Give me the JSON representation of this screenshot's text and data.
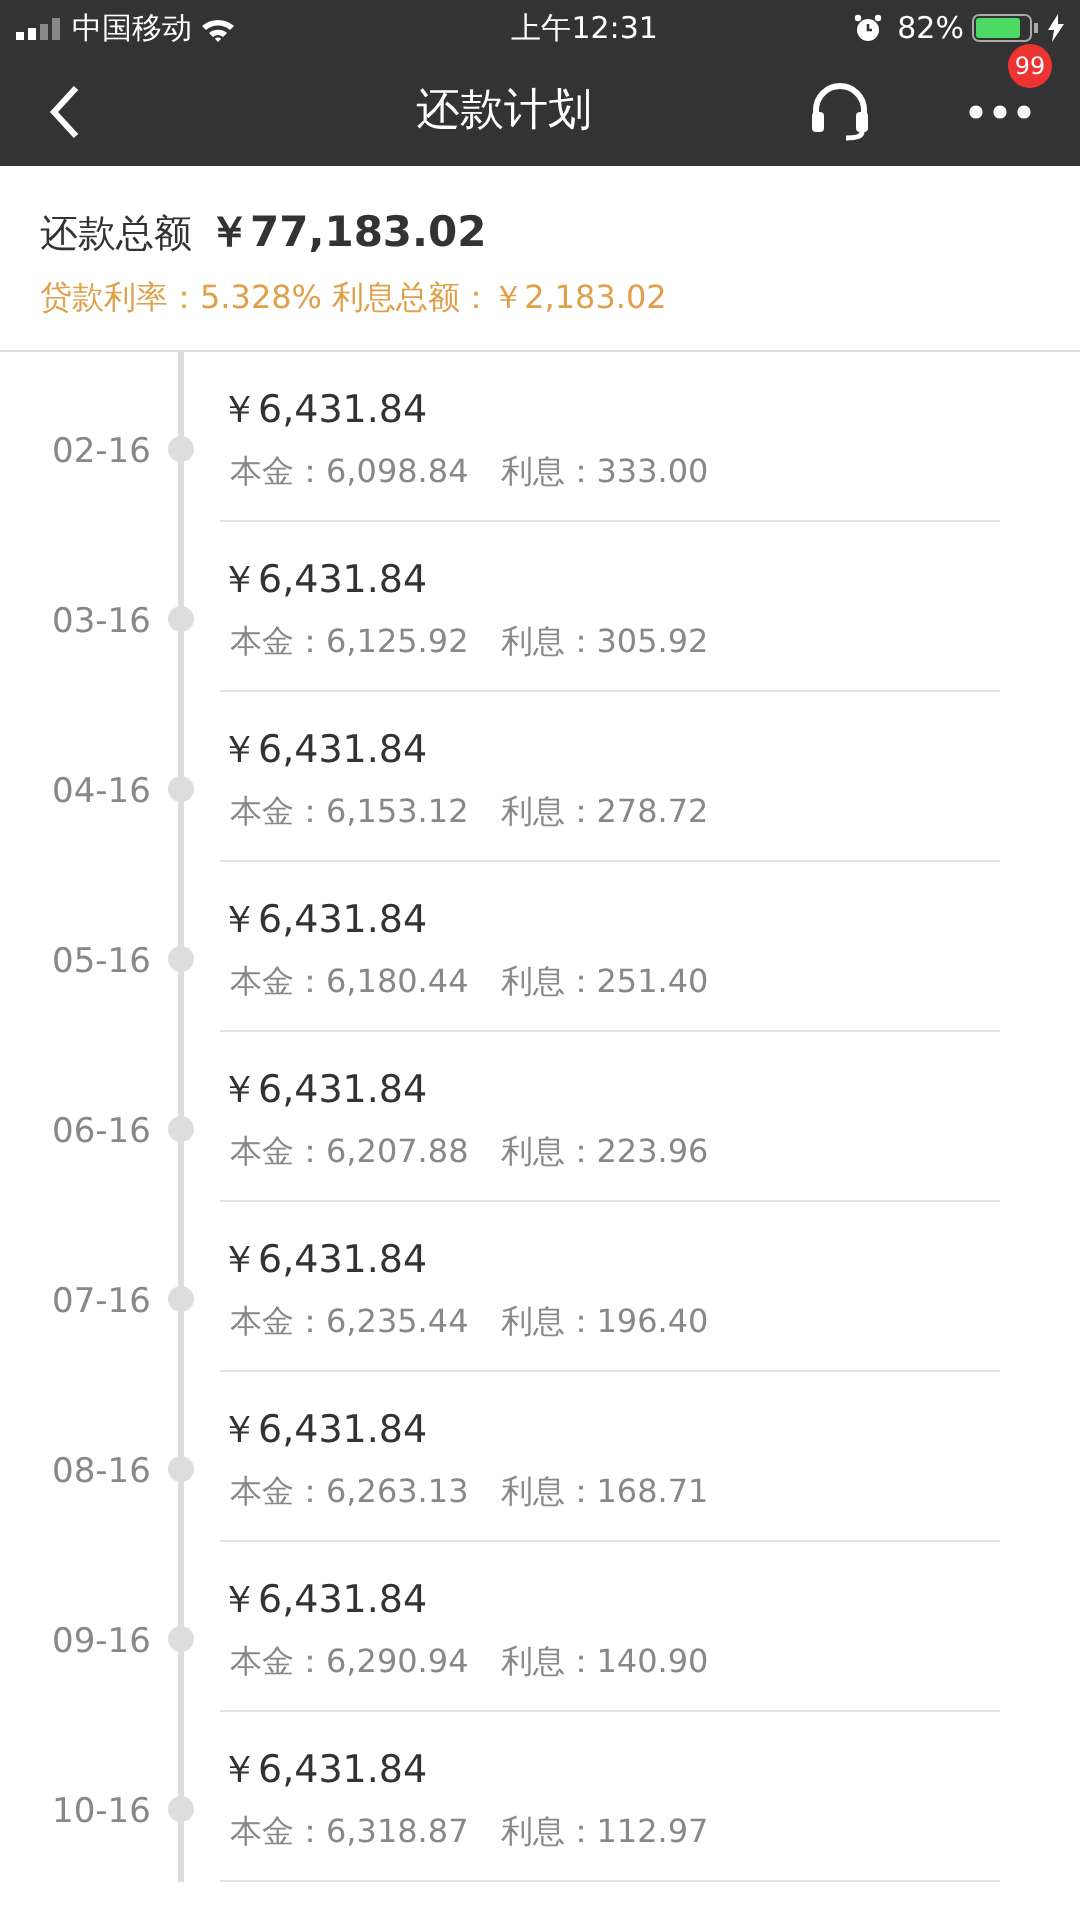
{
  "status_bar": {
    "carrier": "中国移动",
    "time": "上午12:31",
    "battery": "82%"
  },
  "nav": {
    "title": "还款计划",
    "badge": "99"
  },
  "summary": {
    "total_label": "还款总额",
    "total": "￥77,183.02",
    "rate": "贷款利率：5.328% 利息总额：￥2,183.02"
  },
  "schedule": [
    {
      "date": "02-16",
      "amount": "￥6,431.84",
      "principal": "本金：6,098.84",
      "interest": "利息：333.00"
    },
    {
      "date": "03-16",
      "amount": "￥6,431.84",
      "principal": "本金：6,125.92",
      "interest": "利息：305.92"
    },
    {
      "date": "04-16",
      "amount": "￥6,431.84",
      "principal": "本金：6,153.12",
      "interest": "利息：278.72"
    },
    {
      "date": "05-16",
      "amount": "￥6,431.84",
      "principal": "本金：6,180.44",
      "interest": "利息：251.40"
    },
    {
      "date": "06-16",
      "amount": "￥6,431.84",
      "principal": "本金：6,207.88",
      "interest": "利息：223.96"
    },
    {
      "date": "07-16",
      "amount": "￥6,431.84",
      "principal": "本金：6,235.44",
      "interest": "利息：196.40"
    },
    {
      "date": "08-16",
      "amount": "￥6,431.84",
      "principal": "本金：6,263.13",
      "interest": "利息：168.71"
    },
    {
      "date": "09-16",
      "amount": "￥6,431.84",
      "principal": "本金：6,290.94",
      "interest": "利息：140.90"
    },
    {
      "date": "10-16",
      "amount": "￥6,431.84",
      "principal": "本金：6,318.87",
      "interest": "利息：112.97"
    }
  ]
}
